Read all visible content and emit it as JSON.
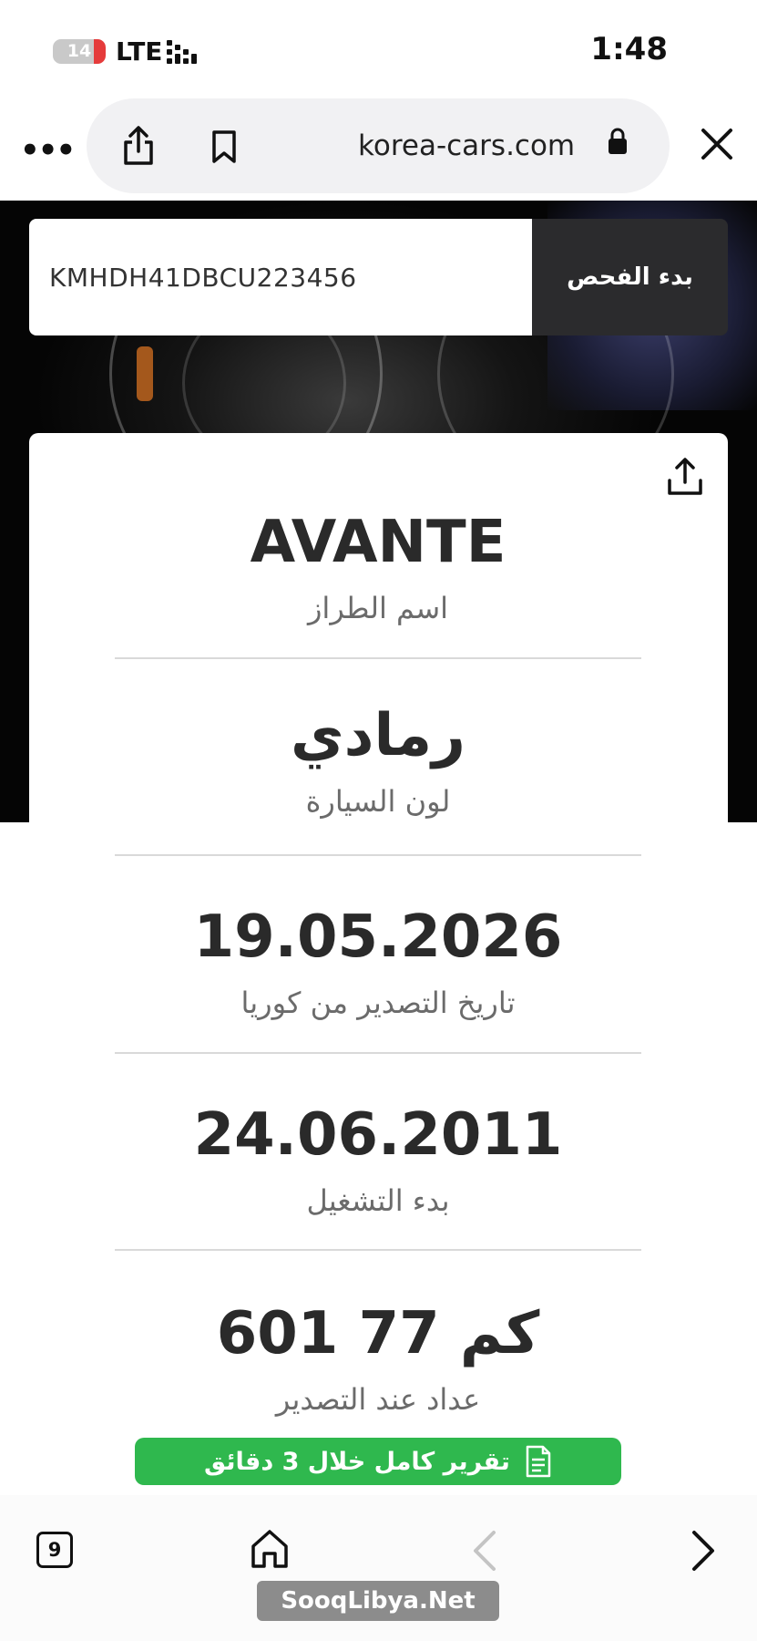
{
  "status_bar": {
    "battery": "14",
    "network": "LTE",
    "time": "1:48"
  },
  "browser": {
    "url": "korea-cars.com"
  },
  "search": {
    "vin": "KMHDH41DBCU223456",
    "button_label": "بدء الفحص"
  },
  "result": {
    "fields": [
      {
        "value": "AVANTE",
        "label": "اسم الطراز"
      },
      {
        "value": "رمادي",
        "label": "لون السيارة"
      },
      {
        "value": "19.05.2026",
        "label": "تاريخ التصدير من كوريا"
      },
      {
        "value": "24.06.2011",
        "label": "بدء التشغيل"
      },
      {
        "value": "كم 77 601",
        "label": "عداد عند التصدير"
      }
    ],
    "cta_label": "تقرير كامل خلال 3 دقائق"
  },
  "toolbar": {
    "tab_count": "9"
  },
  "watermark": "SooqLibya.Net"
}
